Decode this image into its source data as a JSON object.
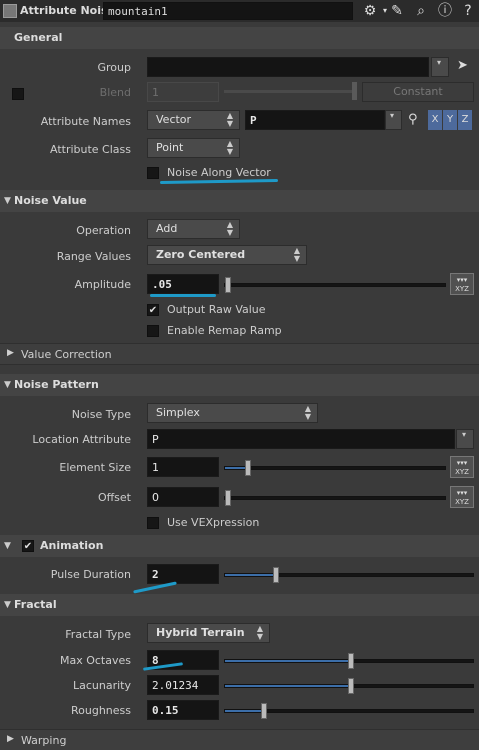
{
  "header": {
    "node_type": "Attribute Noise",
    "node_name": "mountain1"
  },
  "general": {
    "title": "General",
    "group_label": "Group",
    "group_value": "",
    "blend_label": "Blend",
    "blend_value": "1",
    "blend_mode": "Constant",
    "attr_names_label": "Attribute Names",
    "attr_names_type": "Vector",
    "attr_names_value": "P",
    "x": "X",
    "y": "Y",
    "z": "Z",
    "attr_class_label": "Attribute Class",
    "attr_class_value": "Point",
    "noise_along_vector": "Noise Along Vector"
  },
  "noise_value": {
    "title": "Noise Value",
    "operation_label": "Operation",
    "operation_value": "Add",
    "range_label": "Range Values",
    "range_value": "Zero Centered",
    "amplitude_label": "Amplitude",
    "amplitude_value": ".05",
    "output_raw": "Output Raw Value",
    "remap": "Enable Remap Ramp",
    "value_correction": "Value Correction"
  },
  "noise_pattern": {
    "title": "Noise Pattern",
    "noise_type_label": "Noise Type",
    "noise_type_value": "Simplex",
    "location_label": "Location Attribute",
    "location_value": "P",
    "element_size_label": "Element Size",
    "element_size_value": "1",
    "offset_label": "Offset",
    "offset_value": "0",
    "vex_label": "Use VEXpression"
  },
  "animation": {
    "title": "Animation",
    "pulse_label": "Pulse Duration",
    "pulse_value": "2"
  },
  "fractal": {
    "title": "Fractal",
    "type_label": "Fractal Type",
    "type_value": "Hybrid Terrain",
    "octaves_label": "Max Octaves",
    "octaves_value": "8",
    "lacunarity_label": "Lacunarity",
    "lacunarity_value": "2.01234",
    "roughness_label": "Roughness",
    "roughness_value": "0.15"
  },
  "warping": {
    "title": "Warping"
  },
  "colors": {
    "annotation": "#1e9ac8",
    "slider_fill": "#3c6ea8"
  }
}
